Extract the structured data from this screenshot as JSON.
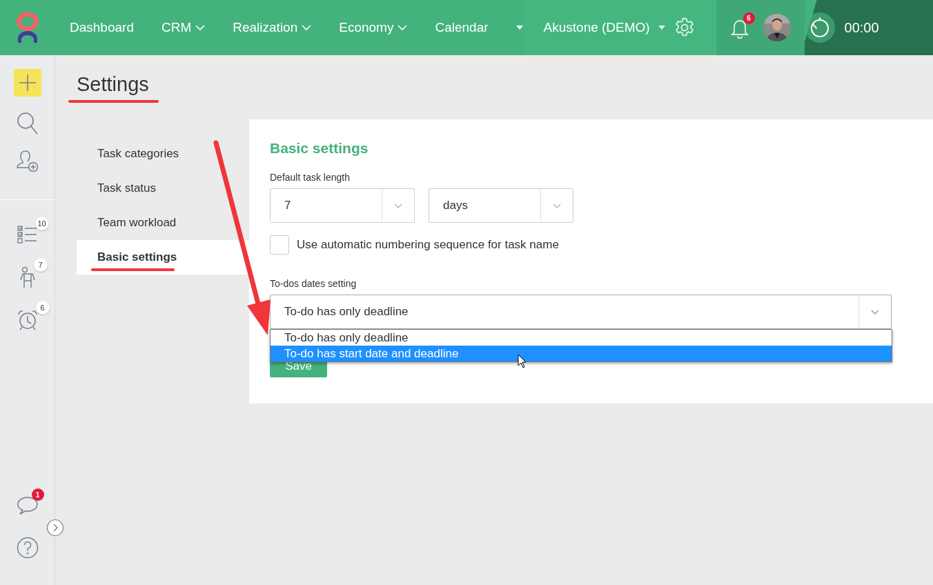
{
  "topbar": {
    "nav": [
      {
        "label": "Dashboard",
        "dropdown": false
      },
      {
        "label": "CRM",
        "dropdown": true
      },
      {
        "label": "Realization",
        "dropdown": true
      },
      {
        "label": "Economy",
        "dropdown": true
      },
      {
        "label": "Calendar",
        "dropdown": false
      }
    ],
    "company": "Akustone (DEMO)",
    "notifications": "6",
    "timer": "00:00"
  },
  "sidebar": {
    "badges": [
      {
        "kind": "tasks",
        "badge": "10"
      },
      {
        "kind": "person",
        "badge": "7"
      },
      {
        "kind": "alarm",
        "badge": "6"
      }
    ],
    "messages_badge": "1"
  },
  "page_title": "Settings",
  "settings_menu": [
    {
      "label": "Task categories",
      "selected": false
    },
    {
      "label": "Task status",
      "selected": false
    },
    {
      "label": "Team workload",
      "selected": false
    },
    {
      "label": "Basic settings",
      "selected": true
    }
  ],
  "panel": {
    "title": "Basic settings",
    "task_length_label": "Default task length",
    "task_length_value": "7",
    "task_length_unit": "days",
    "auto_numbering": {
      "label": "Use automatic numbering sequence for task name",
      "checked": false
    },
    "dates_label": "To-dos dates setting",
    "dates_value": "To-do has only deadline",
    "dates_options": [
      {
        "label": "To-do has only deadline",
        "selected": false
      },
      {
        "label": "To-do has start date and deadline",
        "selected": true
      }
    ],
    "save": "Save"
  }
}
